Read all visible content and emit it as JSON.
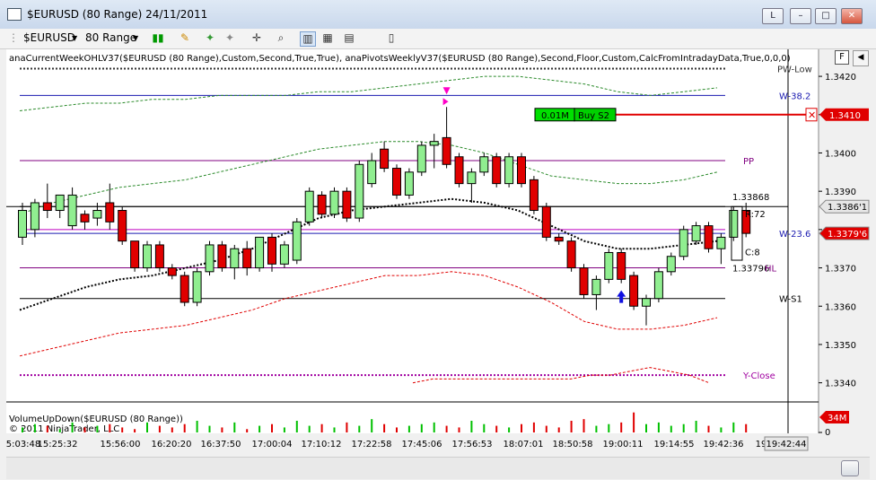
{
  "window": {
    "title": "$EURUSD (80 Range)  24/11/2011",
    "buttons": [
      "L",
      "–",
      "□",
      "✕"
    ]
  },
  "toolbar": {
    "instrument": "$EURUSD",
    "interval": "80 Range",
    "icons": [
      "bar-type-icon",
      "pencil-icon",
      "pin-icon",
      "pin-gray-icon",
      "crosshair-icon",
      "zoom-icon",
      "chart-style-icon",
      "indicators-icon",
      "strategies-icon",
      "properties-icon"
    ]
  },
  "indicator_status": "anaCurrentWeekOHLV37($EURUSD (80 Range),Custom,Second,True,True), anaPivotsWeeklyV37($EURUSD (80 Range),Second,Floor,Custom,CalcFromIntradayData,True,0,0,0)",
  "panel_button": "F",
  "order": {
    "quantity": "0.01M",
    "label": "Buy S2",
    "price": "1.3410",
    "color": "#e00000"
  },
  "volume_label": "VolumeUpDown($EURUSD (80 Range))",
  "copyright": "© 2011 NinjaTrader, LLC",
  "chart_data": {
    "type": "candlestick",
    "title": "$EURUSD (80 Range)",
    "ylim": [
      1.3335,
      1.3424
    ],
    "y_ticks": [
      "1.3340",
      "1.3350",
      "1.3360",
      "1.3370",
      "1.3380",
      "1.3390",
      "1.3400",
      "1.3410",
      "1.3420"
    ],
    "x_ticks": [
      "5:03:48",
      "15:25:32",
      "15:56:00",
      "16:20:20",
      "16:37:50",
      "17:00:04",
      "17:10:12",
      "17:22:58",
      "17:45:06",
      "17:56:53",
      "18:07:01",
      "18:50:58",
      "19:00:11",
      "19:14:55",
      "19:42:36",
      "19"
    ],
    "crosshair_time": "19:42:44",
    "candles": [
      {
        "o": 1.3378,
        "c": 1.3385,
        "h": 1.3387,
        "l": 1.3376
      },
      {
        "o": 1.338,
        "c": 1.3387,
        "h": 1.3388,
        "l": 1.3378
      },
      {
        "o": 1.3387,
        "c": 1.3385,
        "h": 1.3392,
        "l": 1.3383
      },
      {
        "o": 1.3385,
        "c": 1.3389,
        "h": 1.3389,
        "l": 1.3383
      },
      {
        "o": 1.3381,
        "c": 1.3389,
        "h": 1.3391,
        "l": 1.338
      },
      {
        "o": 1.3384,
        "c": 1.3382,
        "h": 1.3385,
        "l": 1.338
      },
      {
        "o": 1.3383,
        "c": 1.3385,
        "h": 1.3387,
        "l": 1.3381
      },
      {
        "o": 1.3387,
        "c": 1.3382,
        "h": 1.3392,
        "l": 1.338
      },
      {
        "o": 1.3385,
        "c": 1.3377,
        "h": 1.3386,
        "l": 1.3376
      },
      {
        "o": 1.3377,
        "c": 1.337,
        "h": 1.3377,
        "l": 1.3369
      },
      {
        "o": 1.337,
        "c": 1.3376,
        "h": 1.3377,
        "l": 1.3369
      },
      {
        "o": 1.3376,
        "c": 1.337,
        "h": 1.3377,
        "l": 1.3369
      },
      {
        "o": 1.337,
        "c": 1.3368,
        "h": 1.3371,
        "l": 1.3367
      },
      {
        "o": 1.3368,
        "c": 1.3361,
        "h": 1.3369,
        "l": 1.336
      },
      {
        "o": 1.3361,
        "c": 1.3369,
        "h": 1.337,
        "l": 1.336
      },
      {
        "o": 1.3369,
        "c": 1.3376,
        "h": 1.3377,
        "l": 1.3368
      },
      {
        "o": 1.3376,
        "c": 1.337,
        "h": 1.3377,
        "l": 1.3369
      },
      {
        "o": 1.337,
        "c": 1.3375,
        "h": 1.3376,
        "l": 1.3367
      },
      {
        "o": 1.3375,
        "c": 1.337,
        "h": 1.3377,
        "l": 1.3368
      },
      {
        "o": 1.337,
        "c": 1.3378,
        "h": 1.3378,
        "l": 1.3369
      },
      {
        "o": 1.3378,
        "c": 1.3371,
        "h": 1.3379,
        "l": 1.3369
      },
      {
        "o": 1.3371,
        "c": 1.3376,
        "h": 1.3377,
        "l": 1.337
      },
      {
        "o": 1.3372,
        "c": 1.3382,
        "h": 1.3383,
        "l": 1.3371
      },
      {
        "o": 1.3382,
        "c": 1.339,
        "h": 1.3391,
        "l": 1.3381
      },
      {
        "o": 1.3389,
        "c": 1.3384,
        "h": 1.339,
        "l": 1.3383
      },
      {
        "o": 1.3384,
        "c": 1.339,
        "h": 1.3391,
        "l": 1.3383
      },
      {
        "o": 1.339,
        "c": 1.3383,
        "h": 1.3391,
        "l": 1.3382
      },
      {
        "o": 1.3383,
        "c": 1.3397,
        "h": 1.3398,
        "l": 1.3382
      },
      {
        "o": 1.3392,
        "c": 1.3398,
        "h": 1.34,
        "l": 1.3391
      },
      {
        "o": 1.3401,
        "c": 1.3396,
        "h": 1.3403,
        "l": 1.3395
      },
      {
        "o": 1.3396,
        "c": 1.3389,
        "h": 1.3397,
        "l": 1.3388
      },
      {
        "o": 1.3389,
        "c": 1.3395,
        "h": 1.3396,
        "l": 1.3388
      },
      {
        "o": 1.3395,
        "c": 1.3402,
        "h": 1.3403,
        "l": 1.3394
      },
      {
        "o": 1.3402,
        "c": 1.3403,
        "h": 1.3405,
        "l": 1.3396
      },
      {
        "o": 1.3404,
        "c": 1.3397,
        "h": 1.3412,
        "l": 1.3396
      },
      {
        "o": 1.3399,
        "c": 1.3392,
        "h": 1.34,
        "l": 1.3391
      },
      {
        "o": 1.3392,
        "c": 1.3395,
        "h": 1.3396,
        "l": 1.3387
      },
      {
        "o": 1.3395,
        "c": 1.3399,
        "h": 1.34,
        "l": 1.3394
      },
      {
        "o": 1.3399,
        "c": 1.3392,
        "h": 1.34,
        "l": 1.3391
      },
      {
        "o": 1.3392,
        "c": 1.3399,
        "h": 1.34,
        "l": 1.3391
      },
      {
        "o": 1.3399,
        "c": 1.3392,
        "h": 1.34,
        "l": 1.3391
      },
      {
        "o": 1.3393,
        "c": 1.3385,
        "h": 1.3394,
        "l": 1.3384
      },
      {
        "o": 1.3386,
        "c": 1.3378,
        "h": 1.3387,
        "l": 1.3377
      },
      {
        "o": 1.3378,
        "c": 1.3377,
        "h": 1.3379,
        "l": 1.3376
      },
      {
        "o": 1.3377,
        "c": 1.337,
        "h": 1.3378,
        "l": 1.3369
      },
      {
        "o": 1.337,
        "c": 1.3363,
        "h": 1.3371,
        "l": 1.3362
      },
      {
        "o": 1.3363,
        "c": 1.3367,
        "h": 1.3368,
        "l": 1.3359
      },
      {
        "o": 1.3367,
        "c": 1.3374,
        "h": 1.3375,
        "l": 1.3366
      },
      {
        "o": 1.3374,
        "c": 1.3367,
        "h": 1.3375,
        "l": 1.3366
      },
      {
        "o": 1.3368,
        "c": 1.336,
        "h": 1.3369,
        "l": 1.3359
      },
      {
        "o": 1.336,
        "c": 1.3362,
        "h": 1.3363,
        "l": 1.3355
      },
      {
        "o": 1.3362,
        "c": 1.3369,
        "h": 1.337,
        "l": 1.3361
      },
      {
        "o": 1.3369,
        "c": 1.3373,
        "h": 1.3374,
        "l": 1.3368
      },
      {
        "o": 1.3373,
        "c": 1.338,
        "h": 1.3381,
        "l": 1.3372
      },
      {
        "o": 1.3377,
        "c": 1.3381,
        "h": 1.3382,
        "l": 1.3376
      },
      {
        "o": 1.3381,
        "c": 1.3375,
        "h": 1.3382,
        "l": 1.3374
      },
      {
        "o": 1.3375,
        "c": 1.3378,
        "h": 1.3379,
        "l": 1.3371
      },
      {
        "o": 1.3378,
        "c": 1.3385,
        "h": 1.3386,
        "l": 1.3377
      },
      {
        "o": 1.3385,
        "c": 1.3379,
        "h": 1.3387,
        "l": 1.3378
      }
    ],
    "horizontal_levels": [
      {
        "label": "PW-Low",
        "value": 1.3422,
        "color": "#333333",
        "dash": true
      },
      {
        "label": "W-38.2",
        "value": 1.3415,
        "color": "#1a1ab0",
        "dash": false
      },
      {
        "label": "PP",
        "value": 1.3398,
        "color": "#800080",
        "dash": false
      },
      {
        "label": "",
        "value": 1.3386,
        "color": "#000000",
        "dash": false
      },
      {
        "label": "W-23.6",
        "value": 1.3379,
        "color": "#1a1ab0",
        "dash": false
      },
      {
        "label": "",
        "value": 1.338,
        "color": "#c000c0",
        "dash": false
      },
      {
        "label": "",
        "value": 1.337,
        "color": "#800080",
        "dash": false
      },
      {
        "label": "W-S1",
        "value": 1.3362,
        "color": "#000000",
        "dash": false
      },
      {
        "label": "Y-Close",
        "value": 1.3342,
        "color": "#a000a0",
        "dash": true
      }
    ],
    "bands": {
      "upper": [
        1.3411,
        1.3412,
        1.3413,
        1.3413,
        1.3414,
        1.3414,
        1.3415,
        1.3415,
        1.3415,
        1.3416,
        1.3416,
        1.3417,
        1.3418,
        1.3419,
        1.342,
        1.342,
        1.3419,
        1.3418,
        1.3416,
        1.3415,
        1.3416,
        1.3417
      ],
      "upper_inner": [
        1.3384,
        1.3387,
        1.3389,
        1.3391,
        1.3392,
        1.3393,
        1.3395,
        1.3397,
        1.3399,
        1.3401,
        1.3402,
        1.3403,
        1.3403,
        1.3402,
        1.34,
        1.3397,
        1.3394,
        1.3393,
        1.3392,
        1.3392,
        1.3393,
        1.3395
      ],
      "mid": [
        1.3359,
        1.3362,
        1.3365,
        1.3367,
        1.3368,
        1.337,
        1.3372,
        1.3375,
        1.3379,
        1.3383,
        1.3385,
        1.3386,
        1.3387,
        1.3388,
        1.3387,
        1.3385,
        1.3381,
        1.3377,
        1.3375,
        1.3375,
        1.3376,
        1.3377
      ],
      "lower_inner": [
        1.3347,
        1.3349,
        1.3351,
        1.3353,
        1.3354,
        1.3355,
        1.3357,
        1.3359,
        1.3362,
        1.3364,
        1.3366,
        1.3368,
        1.3368,
        1.3369,
        1.3368,
        1.3365,
        1.3361,
        1.3356,
        1.3354,
        1.3354,
        1.3355,
        1.3357
      ],
      "lower": [
        1.334,
        1.3341,
        1.3341,
        1.3341,
        1.3341,
        1.3341,
        1.3341,
        1.3341,
        1.3341,
        1.3342,
        1.3342,
        1.3343,
        1.3344,
        1.3343,
        1.3342,
        1.334
      ]
    },
    "price_labels": [
      {
        "text": "1.3386'1",
        "value": 1.3386,
        "bg": "#e6e6e6",
        "fg": "#000000"
      },
      {
        "text": "1.3379'6",
        "value": 1.3379,
        "bg": "#e00000",
        "fg": "#ffffff"
      }
    ],
    "bar_info": {
      "open": "1.33868",
      "range": "R:72",
      "count": "C:8",
      "low": "1.33796",
      "hl": "HL"
    },
    "signals": [
      {
        "type": "sell",
        "index": 34
      },
      {
        "type": "buy",
        "index": 48
      }
    ],
    "volume": {
      "max": 34,
      "max_label": "34M",
      "values": [
        3,
        5,
        4,
        2,
        6,
        3,
        4,
        5,
        3,
        2,
        6,
        4,
        3,
        5,
        7,
        4,
        3,
        6,
        2,
        4,
        5,
        3,
        7,
        4,
        5,
        3,
        6,
        4,
        8,
        5,
        3,
        4,
        5,
        6,
        4,
        3,
        7,
        5,
        4,
        3,
        5,
        6,
        4,
        3,
        7,
        8,
        4,
        5,
        6,
        12,
        5,
        6,
        4,
        5,
        7,
        4,
        3,
        6,
        5
      ]
    }
  }
}
